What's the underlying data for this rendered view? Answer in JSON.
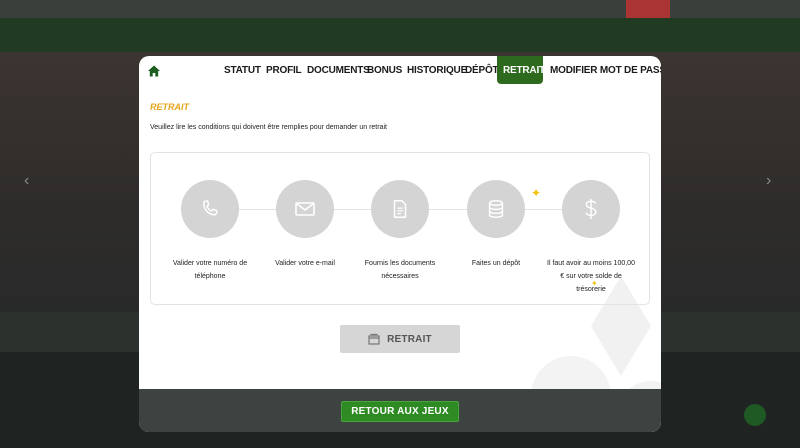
{
  "modal": {
    "tabs": [
      {
        "label": "STATUT"
      },
      {
        "label": "PROFIL"
      },
      {
        "label": "DOCUMENTS"
      },
      {
        "label": "BONUS"
      },
      {
        "label": "HISTORIQUE"
      },
      {
        "label": "DÉPÔT"
      },
      {
        "label": "RETRAIT",
        "active": true
      },
      {
        "label": "MODIFIER MOT DE PASSE"
      }
    ],
    "title": "RETRAIT",
    "intro": "Veuillez lire les conditions qui doivent être remplies pour demander un retrait",
    "steps": [
      {
        "icon": "phone-icon",
        "label": "Valider votre numéro de téléphone"
      },
      {
        "icon": "envelope-icon",
        "label": "Valider votre e-mail"
      },
      {
        "icon": "document-icon",
        "label": "Fournis les documents nécessaires"
      },
      {
        "icon": "database-icon",
        "label": "Faites un dépôt"
      },
      {
        "icon": "dollar-icon",
        "label": "Il faut avoir au moins 100,00 € sur votre solde de trésorerie"
      }
    ],
    "retrait_button": "RETRAIT",
    "return_button": "RETOUR AUX JEUX"
  },
  "colors": {
    "accent_green": "#2d6a1e",
    "title_orange": "#e6a41a",
    "footer": "#3d4341",
    "step_circle": "#d4d4d4"
  }
}
